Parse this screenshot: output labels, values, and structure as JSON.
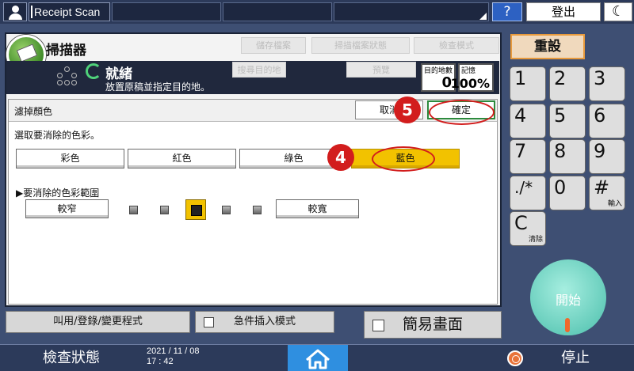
{
  "topbar": {
    "app_name": "Receipt Scan",
    "help_label": "?",
    "logout_label": "登出",
    "moon_label": "☾"
  },
  "scanner": {
    "title": "掃描器",
    "btn_save_file": "儲存檔案",
    "btn_scan_status": "掃描檔案狀態",
    "btn_check_mode": "檢查模式",
    "ready": "就緒",
    "ready_sub": "放置原稿並指定目的地。",
    "btn_dest": "搜尋目的地",
    "btn_preview": "預覽",
    "dest_count_label": "目的地數",
    "dest_count": "0",
    "memory_label": "記憶",
    "memory_value": "100%"
  },
  "filter": {
    "title": "濾掉顏色",
    "cancel_label": "取消",
    "ok_label": "確定",
    "instruction": "選取要消除的色彩。",
    "colors": [
      "彩色",
      "紅色",
      "綠色",
      "藍色"
    ],
    "selected_color": "藍色",
    "range_label": "▶要消除的色彩範圍",
    "narrow_label": "較窄",
    "wide_label": "較寬",
    "range_level": 3,
    "range_levels": 7,
    "callouts": [
      "5",
      "4"
    ],
    "accent_color": "#f2c200",
    "callout_color": "#d21d1d"
  },
  "bottom_buttons": {
    "program": "叫用/登錄/變更程式",
    "interrupt": "急件插入模式",
    "simple_screen": "簡易畫面"
  },
  "keypad": {
    "reset_label": "重設",
    "keys": [
      {
        "digit": "1",
        "sub": ""
      },
      {
        "digit": "2",
        "sub": ""
      },
      {
        "digit": "3",
        "sub": ""
      },
      {
        "digit": "4",
        "sub": ""
      },
      {
        "digit": "5",
        "sub": ""
      },
      {
        "digit": "6",
        "sub": ""
      },
      {
        "digit": "7",
        "sub": ""
      },
      {
        "digit": "8",
        "sub": ""
      },
      {
        "digit": "9",
        "sub": ""
      },
      {
        "digit": "./*",
        "sub": ""
      },
      {
        "digit": "0",
        "sub": ""
      },
      {
        "digit": "#",
        "sub": "輸入"
      },
      {
        "digit": "C",
        "sub": "清除"
      }
    ],
    "start_label": "開始"
  },
  "bottombar": {
    "check_status": "檢查狀態",
    "date": "2021 / 11 / 08",
    "time": "17 : 42",
    "home_icon": "home-icon",
    "stop_label": "停止"
  }
}
